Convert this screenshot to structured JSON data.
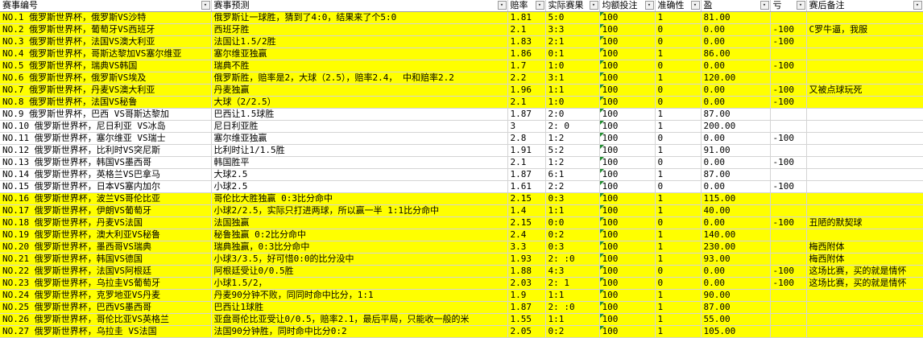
{
  "headers": [
    "赛事编号",
    "赛事预测",
    "赔率",
    "实际赛果",
    "均额投注",
    "准确性",
    "盈",
    "亏",
    "赛后备注"
  ],
  "rows": [
    {
      "hl": true,
      "c": [
        "NO.1 俄罗斯世界杯，俄罗斯VS沙特",
        "俄罗斯让一球胜，猜到了4:0，结果来了个5:0",
        "1.81",
        "5:0",
        "100",
        "1",
        "81.00",
        "",
        ""
      ]
    },
    {
      "hl": true,
      "c": [
        "NO.2 俄罗斯世界杯，葡萄牙VS西班牙",
        "西班牙胜",
        "2.1",
        "3:3",
        "100",
        "0",
        "0.00",
        "-100",
        "C罗牛逼，我服"
      ]
    },
    {
      "hl": true,
      "c": [
        "NO.3 俄罗斯世界杯，法国VS澳大利亚",
        "法国让1.5/2胜",
        "1.83",
        "2:1",
        "100",
        "0",
        "0.00",
        "-100",
        ""
      ]
    },
    {
      "hl": true,
      "c": [
        "NO.4 俄罗斯世界杯，哥斯达黎加VS塞尔维亚",
        "塞尔维亚独赢",
        "1.86",
        "0:1",
        "100",
        "1",
        "86.00",
        "",
        ""
      ]
    },
    {
      "hl": true,
      "c": [
        "NO.5 俄罗斯世界杯，瑞典VS韩国",
        "瑞典不胜",
        "1.7",
        "1:0",
        "100",
        "0",
        "0.00",
        "-100",
        ""
      ]
    },
    {
      "hl": true,
      "c": [
        "NO.6 俄罗斯世界杯，俄罗斯VS埃及",
        "俄罗斯胜，赔率是2，大球（2.5），赔率2.4，  中和赔率2.2",
        "2.2",
        "3:1",
        "100",
        "1",
        "120.00",
        "",
        ""
      ]
    },
    {
      "hl": true,
      "c": [
        "NO.7 俄罗斯世界杯，丹麦VS澳大利亚",
        "丹麦独赢",
        "1.96",
        "1:1",
        "100",
        "0",
        "0.00",
        "-100",
        "又被点球玩死"
      ]
    },
    {
      "hl": true,
      "c": [
        "NO.8 俄罗斯世界杯，法国VS秘鲁",
        "大球（2/2.5）",
        "2.1",
        "1:0",
        "100",
        "0",
        "0.00",
        "-100",
        ""
      ]
    },
    {
      "hl": false,
      "c": [
        "NO.9 俄罗斯世界杯，巴西 VS哥斯达黎加",
        "巴西让1.5球胜",
        "1.87",
        "2:0",
        "100",
        "1",
        "87.00",
        "",
        ""
      ]
    },
    {
      "hl": false,
      "c": [
        "NO.10 俄罗斯世界杯，尼日利亚 VS冰岛",
        "尼日利亚胜",
        "3",
        "2: 0",
        "100",
        "1",
        "200.00",
        "",
        ""
      ]
    },
    {
      "hl": false,
      "c": [
        "NO.11 俄罗斯世界杯，塞尔维亚 VS瑞士",
        "塞尔维亚独赢",
        "2.8",
        "1:2",
        "100",
        "0",
        "0.00",
        "-100",
        ""
      ]
    },
    {
      "hl": false,
      "c": [
        "NO.12 俄罗斯世界杯，比利时VS突尼斯",
        "比利时让1/1.5胜",
        "1.91",
        "5:2",
        "100",
        "1",
        "91.00",
        "",
        ""
      ]
    },
    {
      "hl": false,
      "c": [
        "NO.13 俄罗斯世界杯，韩国VS墨西哥",
        "韩国胜平",
        "2.1",
        "1:2",
        "100",
        "0",
        "0.00",
        "-100",
        ""
      ]
    },
    {
      "hl": false,
      "c": [
        "NO.14 俄罗斯世界杯，英格兰VS巴拿马",
        "大球2.5",
        "1.87",
        "6:1",
        "100",
        "1",
        "87.00",
        "",
        ""
      ]
    },
    {
      "hl": false,
      "c": [
        "NO.15 俄罗斯世界杯，日本VS塞内加尔",
        "小球2.5",
        "1.61",
        "2:2",
        "100",
        "0",
        "0.00",
        "-100",
        ""
      ]
    },
    {
      "hl": true,
      "c": [
        "NO.16 俄罗斯世界杯，波兰VS哥伦比亚",
        "哥伦比大胜独赢  0:3比分命中",
        "2.15",
        "0:3",
        "100",
        "1",
        "115.00",
        "",
        ""
      ]
    },
    {
      "hl": true,
      "c": [
        "NO.17 俄罗斯世界杯，伊朗VS葡萄牙",
        "小球2/2.5，实际只打进两球，所以赢一半 1:1比分命中",
        "1.4",
        "1:1",
        "100",
        "1",
        "40.00",
        "",
        ""
      ]
    },
    {
      "hl": true,
      "c": [
        "NO.18 俄罗斯世界杯，丹麦VS法国",
        "法国独赢",
        "2.15",
        "0:0",
        "100",
        "0",
        "0.00",
        "-100",
        "丑陋的默契球"
      ]
    },
    {
      "hl": true,
      "c": [
        "NO.19 俄罗斯世界杯，澳大利亚VS秘鲁",
        "秘鲁独赢  0:2比分命中",
        "2.4",
        "0:2",
        "100",
        "1",
        "140.00",
        "",
        ""
      ]
    },
    {
      "hl": true,
      "c": [
        "NO.20 俄罗斯世界杯，墨西哥VS瑞典",
        "瑞典独赢，0:3比分命中",
        "3.3",
        "0:3",
        "100",
        "1",
        "230.00",
        "",
        "梅西附体"
      ]
    },
    {
      "hl": true,
      "c": [
        "NO.21 俄罗斯世界杯，韩国VS德国",
        "小球3/3.5，好可惜0:0的比分没中",
        "1.93",
        "2: :0",
        "100",
        "1",
        "93.00",
        "",
        "梅西附体"
      ]
    },
    {
      "hl": true,
      "c": [
        "NO.22  俄罗斯世界杯，法国VS阿根廷",
        "阿根廷受让0/0.5胜",
        "1.88",
        "4:3",
        "100",
        "0",
        "0.00",
        "-100",
        "这场比赛，买的就是情怀"
      ]
    },
    {
      "hl": true,
      "c": [
        "NO.23  俄罗斯世界杯，乌拉圭VS葡萄牙",
        "小球1.5/2，",
        "2.03",
        "2: 1",
        "100",
        "0",
        "0.00",
        "-100",
        "这场比赛，买的就是情怀"
      ]
    },
    {
      "hl": true,
      "c": [
        "NO.24  俄罗斯世界杯，克罗地亚VS丹麦",
        "丹麦90分钟不败，同同时命中比分，1:1",
        "1.9",
        "1:1",
        "100",
        "1",
        "90.00",
        "",
        ""
      ]
    },
    {
      "hl": true,
      "c": [
        "NO.25  俄罗斯世界杯，巴西VS墨西哥",
        "巴西让1球胜",
        "1.87",
        "2: :0",
        "100",
        "1",
        "87.00",
        "",
        ""
      ]
    },
    {
      "hl": true,
      "c": [
        "NO.26  俄罗斯世界杯，哥伦比亚VS英格兰",
        "亚盘哥伦比亚受让0/0.5，赔率2.1，最后平局，只能收一般的米",
        "1.55",
        "1:1",
        "100",
        "1",
        "55.00",
        "",
        ""
      ]
    },
    {
      "hl": true,
      "c": [
        "NO.27  俄罗斯世界杯，乌拉圭 VS法国",
        "法国90分钟胜，同时命中比分0:2",
        "2.05",
        "0:2",
        "100",
        "1",
        "105.00",
        "",
        ""
      ]
    }
  ]
}
